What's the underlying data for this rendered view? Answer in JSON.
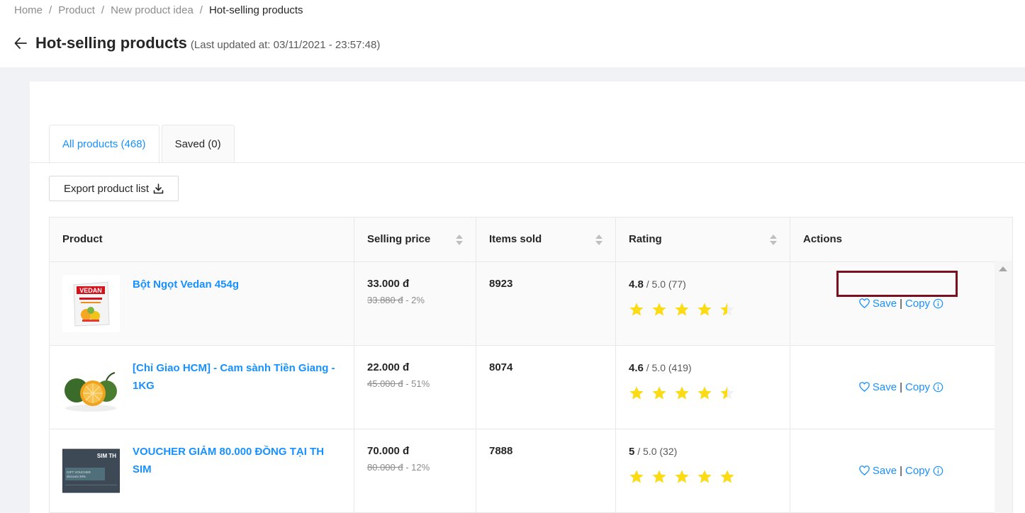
{
  "breadcrumb": [
    "Home",
    "Product",
    "New product idea",
    "Hot-selling products"
  ],
  "page": {
    "title": "Hot-selling products",
    "last_updated": "(Last updated at: 03/11/2021 - 23:57:48)"
  },
  "tabs": [
    {
      "label": "All products (468)",
      "active": true
    },
    {
      "label": "Saved (0)",
      "active": false
    }
  ],
  "export_button": {
    "label": "Export product list",
    "icon": "download-icon"
  },
  "table": {
    "columns": [
      "Product",
      "Selling price",
      "Items sold",
      "Rating",
      "Actions"
    ],
    "rows": [
      {
        "name": "Bột Ngọt Vedan 454g",
        "image": "vedan-package",
        "price": "33.000 đ",
        "old_price": "33.880 đ",
        "discount": "- 2%",
        "sold": "8923",
        "rating": "4.8",
        "rating_suffix": "/ 5.0 (77)",
        "stars": 4.5,
        "save_label": "Save",
        "copy_label": "Copy"
      },
      {
        "name": "[Chỉ Giao HCM] - Cam sành Tiền Giang - 1KG",
        "image": "oranges",
        "price": "22.000 đ",
        "old_price": "45.000 đ",
        "discount": "- 51%",
        "sold": "8074",
        "rating": "4.6",
        "rating_suffix": "/ 5.0 (419)",
        "stars": 4.5,
        "save_label": "Save",
        "copy_label": "Copy"
      },
      {
        "name": "VOUCHER GIẢM 80.000 ĐỒNG TẠI TH SIM",
        "image": "voucher-card",
        "price": "70.000 đ",
        "old_price": "80.000 đ",
        "discount": "- 12%",
        "sold": "7888",
        "rating": "5",
        "rating_suffix": "/ 5.0 (32)",
        "stars": 5,
        "save_label": "Save",
        "copy_label": "Copy"
      }
    ]
  },
  "thumb_text": {
    "vedan": "VEDAN",
    "voucher_title": "SIM TH",
    "voucher_line1": "GIFT VOUCHER",
    "voucher_line2": "discount 20%"
  },
  "colors": {
    "link": "#1890ff",
    "star": "#fadb14",
    "highlight_border": "#7b0f1f",
    "background": "#f0f2f5"
  }
}
